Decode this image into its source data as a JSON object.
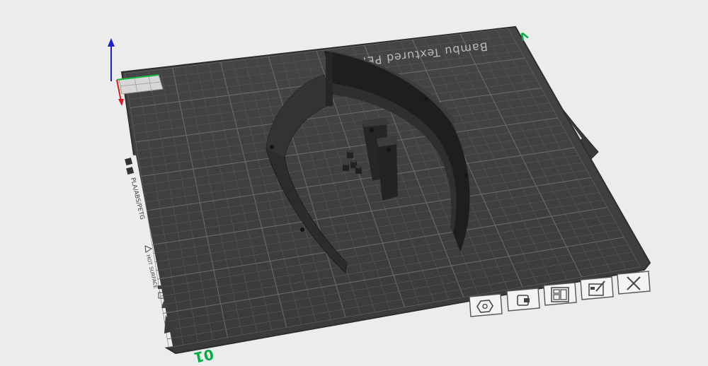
{
  "plate": {
    "name_label": "Bambu Textured PEI Plate",
    "filament_label": "PLA/ABS/PETG",
    "warning_label": "HOT SURFACE"
  },
  "plate_number": "01",
  "axis_marker": "V",
  "toolbar": {
    "buttons": [
      {
        "name": "auto-orient-button",
        "icon": "gear-hex-icon"
      },
      {
        "name": "lock-plate-button",
        "icon": "lock-icon"
      },
      {
        "name": "arrange-plate-button",
        "icon": "grid-arrange-icon"
      },
      {
        "name": "plate-settings-button",
        "icon": "edit-settings-icon"
      },
      {
        "name": "remove-plate-button",
        "icon": "close-icon"
      }
    ]
  },
  "colors": {
    "background": "#ececec",
    "plate_surface": "#3c3c3c",
    "grid_line": "#5a5a5a",
    "model": "#2a2a2a",
    "accent_green": "#00ae42"
  }
}
